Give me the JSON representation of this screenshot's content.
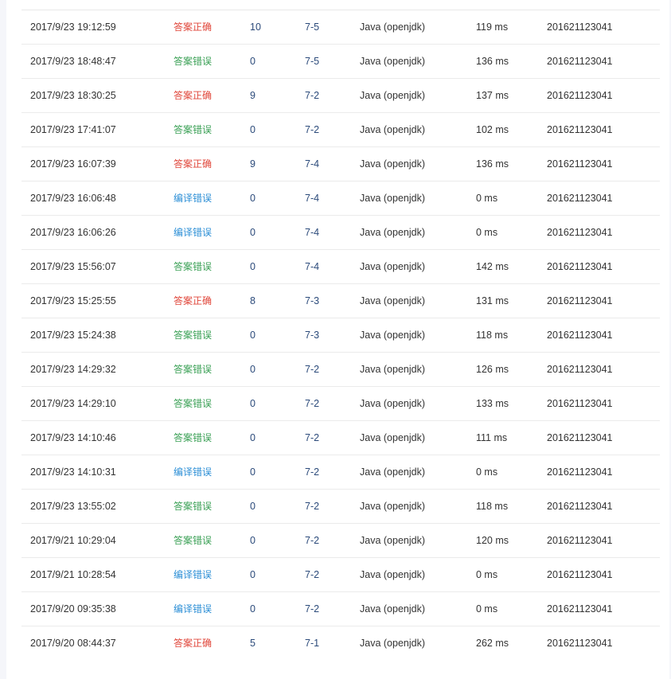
{
  "colors": {
    "accepted": "#e0463a",
    "wrong_answer": "#3aa055",
    "compile_error": "#2d8fd6"
  },
  "submissions": [
    {
      "time": "2017/9/23 19:12:59",
      "status": "答案正确",
      "status_type": "accepted",
      "score": "10",
      "problem": "7-5",
      "language": "Java (openjdk)",
      "time_used": "119 ms",
      "user": "201621123041"
    },
    {
      "time": "2017/9/23 18:48:47",
      "status": "答案错误",
      "status_type": "wrong_answer",
      "score": "0",
      "problem": "7-5",
      "language": "Java (openjdk)",
      "time_used": "136 ms",
      "user": "201621123041"
    },
    {
      "time": "2017/9/23 18:30:25",
      "status": "答案正确",
      "status_type": "accepted",
      "score": "9",
      "problem": "7-2",
      "language": "Java (openjdk)",
      "time_used": "137 ms",
      "user": "201621123041"
    },
    {
      "time": "2017/9/23 17:41:07",
      "status": "答案错误",
      "status_type": "wrong_answer",
      "score": "0",
      "problem": "7-2",
      "language": "Java (openjdk)",
      "time_used": "102 ms",
      "user": "201621123041"
    },
    {
      "time": "2017/9/23 16:07:39",
      "status": "答案正确",
      "status_type": "accepted",
      "score": "9",
      "problem": "7-4",
      "language": "Java (openjdk)",
      "time_used": "136 ms",
      "user": "201621123041"
    },
    {
      "time": "2017/9/23 16:06:48",
      "status": "编译错误",
      "status_type": "compile_error",
      "score": "0",
      "problem": "7-4",
      "language": "Java (openjdk)",
      "time_used": "0 ms",
      "user": "201621123041"
    },
    {
      "time": "2017/9/23 16:06:26",
      "status": "编译错误",
      "status_type": "compile_error",
      "score": "0",
      "problem": "7-4",
      "language": "Java (openjdk)",
      "time_used": "0 ms",
      "user": "201621123041"
    },
    {
      "time": "2017/9/23 15:56:07",
      "status": "答案错误",
      "status_type": "wrong_answer",
      "score": "0",
      "problem": "7-4",
      "language": "Java (openjdk)",
      "time_used": "142 ms",
      "user": "201621123041"
    },
    {
      "time": "2017/9/23 15:25:55",
      "status": "答案正确",
      "status_type": "accepted",
      "score": "8",
      "problem": "7-3",
      "language": "Java (openjdk)",
      "time_used": "131 ms",
      "user": "201621123041"
    },
    {
      "time": "2017/9/23 15:24:38",
      "status": "答案错误",
      "status_type": "wrong_answer",
      "score": "0",
      "problem": "7-3",
      "language": "Java (openjdk)",
      "time_used": "118 ms",
      "user": "201621123041"
    },
    {
      "time": "2017/9/23 14:29:32",
      "status": "答案错误",
      "status_type": "wrong_answer",
      "score": "0",
      "problem": "7-2",
      "language": "Java (openjdk)",
      "time_used": "126 ms",
      "user": "201621123041"
    },
    {
      "time": "2017/9/23 14:29:10",
      "status": "答案错误",
      "status_type": "wrong_answer",
      "score": "0",
      "problem": "7-2",
      "language": "Java (openjdk)",
      "time_used": "133 ms",
      "user": "201621123041"
    },
    {
      "time": "2017/9/23 14:10:46",
      "status": "答案错误",
      "status_type": "wrong_answer",
      "score": "0",
      "problem": "7-2",
      "language": "Java (openjdk)",
      "time_used": "111 ms",
      "user": "201621123041"
    },
    {
      "time": "2017/9/23 14:10:31",
      "status": "编译错误",
      "status_type": "compile_error",
      "score": "0",
      "problem": "7-2",
      "language": "Java (openjdk)",
      "time_used": "0 ms",
      "user": "201621123041"
    },
    {
      "time": "2017/9/23 13:55:02",
      "status": "答案错误",
      "status_type": "wrong_answer",
      "score": "0",
      "problem": "7-2",
      "language": "Java (openjdk)",
      "time_used": "118 ms",
      "user": "201621123041"
    },
    {
      "time": "2017/9/21 10:29:04",
      "status": "答案错误",
      "status_type": "wrong_answer",
      "score": "0",
      "problem": "7-2",
      "language": "Java (openjdk)",
      "time_used": "120 ms",
      "user": "201621123041"
    },
    {
      "time": "2017/9/21 10:28:54",
      "status": "编译错误",
      "status_type": "compile_error",
      "score": "0",
      "problem": "7-2",
      "language": "Java (openjdk)",
      "time_used": "0 ms",
      "user": "201621123041"
    },
    {
      "time": "2017/9/20 09:35:38",
      "status": "编译错误",
      "status_type": "compile_error",
      "score": "0",
      "problem": "7-2",
      "language": "Java (openjdk)",
      "time_used": "0 ms",
      "user": "201621123041"
    },
    {
      "time": "2017/9/20 08:44:37",
      "status": "答案正确",
      "status_type": "accepted",
      "score": "5",
      "problem": "7-1",
      "language": "Java (openjdk)",
      "time_used": "262 ms",
      "user": "201621123041"
    }
  ]
}
